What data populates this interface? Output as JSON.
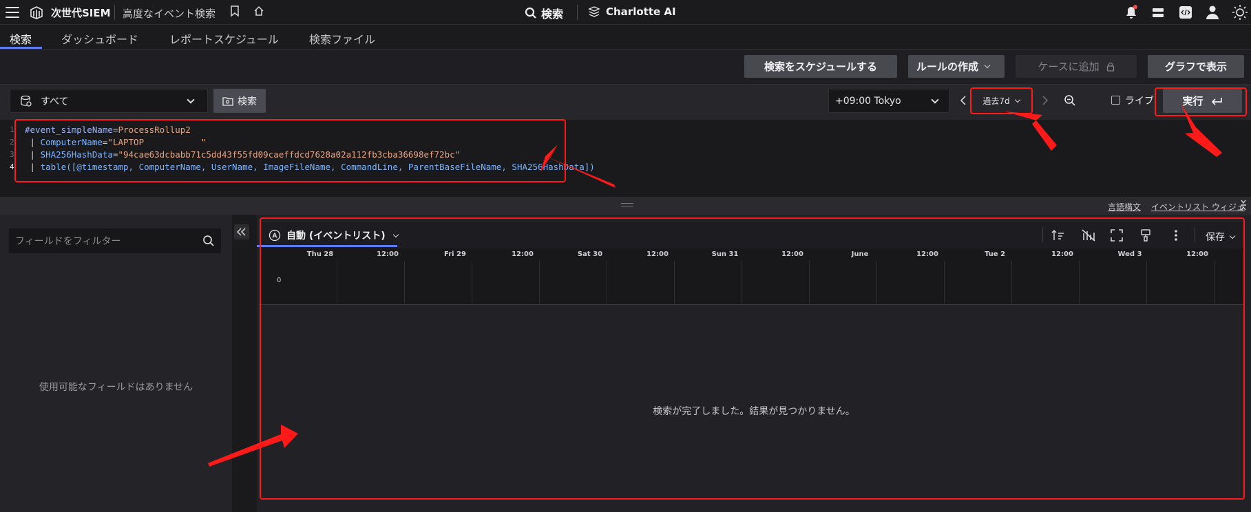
{
  "app": {
    "brand": "次世代SIEM",
    "breadcrumb": "高度なイベント検索",
    "search_label": "検索",
    "charlotte_label": "Charlotte AI"
  },
  "tabs": [
    "検索",
    "ダッシュボード",
    "レポートスケジュール",
    "検索ファイル"
  ],
  "actions": {
    "schedule": "検索をスケジュールする",
    "create_rule": "ルールの作成",
    "add_case": "ケースに追加",
    "graph": "グラフで表示"
  },
  "query_bar": {
    "repo": "すべて",
    "search_btn": "検索",
    "timezone": "+09:00 Tokyo",
    "range": "過去7d",
    "live": "ライブ",
    "run": "実行"
  },
  "query": {
    "line_numbers": [
      "1",
      "2",
      "3",
      "4"
    ],
    "l1_field": "#event_simpleName",
    "l1_eq": "=",
    "l1_value": "ProcessRollup2",
    "l2_pipe": " | ",
    "l2_field": "ComputerName",
    "l2_eq": "=",
    "l2_value": "\"LAPTOP           \"",
    "l3_field": "SHA256HashData",
    "l3_value": "\"94cae63dcbabb71c5dd43f55fd09caeffdcd7628a02a112fb3cba36698ef72bc\"",
    "l4_fn": "table",
    "l4_args": "([@timestamp, ComputerName, UserName, ImageFileName, CommandLine, ParentBaseFileName, SHA256HashData])"
  },
  "links": {
    "syntax": "言語構文",
    "widget": "イベントリスト ウィジェット"
  },
  "left_panel": {
    "filter_placeholder": "フィールドをフィルター",
    "empty": "使用可能なフィールドはありません"
  },
  "results": {
    "view": "自動 (イベントリスト)",
    "save": "保存",
    "y_zero": "0",
    "timeline_labels": [
      "Thu 28",
      "12:00",
      "Fri 29",
      "12:00",
      "Sat 30",
      "12:00",
      "Sun 31",
      "12:00",
      "June",
      "12:00",
      "Tue 2",
      "12:00",
      "Wed 3",
      "12:00"
    ],
    "message": "検索が完了しました。結果が見つかりません。"
  },
  "colors": {
    "accent": "#5b7cf5",
    "annotation": "#ff1a1a"
  }
}
